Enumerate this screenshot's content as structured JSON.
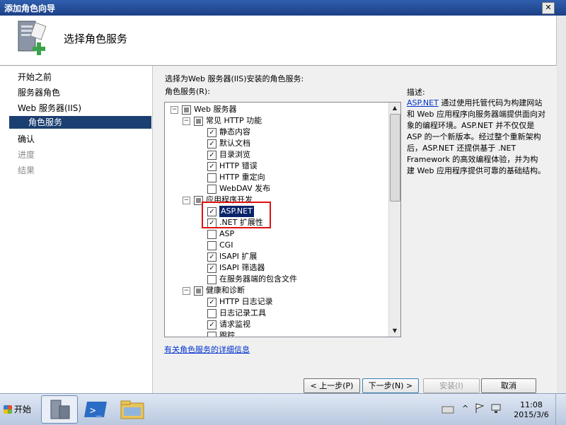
{
  "window": {
    "title": "添加角色向导",
    "close_glyph": "✕"
  },
  "header": {
    "page_title": "选择角色服务",
    "icon": "server-add-icon"
  },
  "nav": {
    "items": [
      {
        "label": "开始之前",
        "state": "normal"
      },
      {
        "label": "服务器角色",
        "state": "normal"
      },
      {
        "label": "Web 服务器(IIS)",
        "state": "normal"
      },
      {
        "label": "角色服务",
        "state": "selected"
      },
      {
        "label": "确认",
        "state": "normal"
      },
      {
        "label": "进度",
        "state": "disabled"
      },
      {
        "label": "结果",
        "state": "disabled"
      }
    ]
  },
  "main": {
    "instruction": "选择为Web 服务器(IIS)安装的角色服务:",
    "list_label": "角色服务(R):",
    "tree": [
      {
        "label": "Web 服务器",
        "level": 0,
        "expander": "−",
        "check": "partial"
      },
      {
        "label": "常见 HTTP 功能",
        "level": 1,
        "expander": "−",
        "check": "partial"
      },
      {
        "label": "静态内容",
        "level": 2,
        "check": "checked"
      },
      {
        "label": "默认文档",
        "level": 2,
        "check": "checked"
      },
      {
        "label": "目录浏览",
        "level": 2,
        "check": "checked"
      },
      {
        "label": "HTTP 错误",
        "level": 2,
        "check": "checked"
      },
      {
        "label": "HTTP 重定向",
        "level": 2,
        "check": "unchecked"
      },
      {
        "label": "WebDAV 发布",
        "level": 2,
        "check": "unchecked"
      },
      {
        "label": "应用程序开发",
        "level": 1,
        "expander": "−",
        "check": "partial"
      },
      {
        "label": "ASP.NET",
        "level": 2,
        "check": "checked",
        "highlight": true
      },
      {
        "label": ".NET 扩展性",
        "level": 2,
        "check": "checked"
      },
      {
        "label": "ASP",
        "level": 2,
        "check": "unchecked"
      },
      {
        "label": "CGI",
        "level": 2,
        "check": "unchecked"
      },
      {
        "label": "ISAPI 扩展",
        "level": 2,
        "check": "checked"
      },
      {
        "label": "ISAPI 筛选器",
        "level": 2,
        "check": "checked"
      },
      {
        "label": "在服务器端的包含文件",
        "level": 2,
        "check": "unchecked"
      },
      {
        "label": "健康和诊断",
        "level": 1,
        "expander": "−",
        "check": "partial"
      },
      {
        "label": "HTTP 日志记录",
        "level": 2,
        "check": "checked"
      },
      {
        "label": "日志记录工具",
        "level": 2,
        "check": "unchecked"
      },
      {
        "label": "请求监视",
        "level": 2,
        "check": "checked"
      },
      {
        "label": "跟踪",
        "level": 2,
        "check": "unchecked"
      }
    ],
    "description_label": "描述:",
    "description_link": "ASP.NET",
    "description_text": " 通过使用托管代码为构建网站和 Web 应用程序向服务器端提供面向对象的编程环境。ASP.NET 并不仅仅是 ASP 的一个新版本。经过整个重新架构后，ASP.NET 还提供基于 .NET Framework 的高效编程体验，并为构建 Web 应用程序提供可靠的基础结构。",
    "more_info_link": "有关角色服务的详细信息"
  },
  "buttons": {
    "prev": "< 上一步(P)",
    "next": "下一步(N) >",
    "install": "安装(I)",
    "cancel": "取消"
  },
  "taskbar": {
    "start_label": "开始",
    "clock_time": "11:08",
    "clock_date": "2015/3/6"
  }
}
